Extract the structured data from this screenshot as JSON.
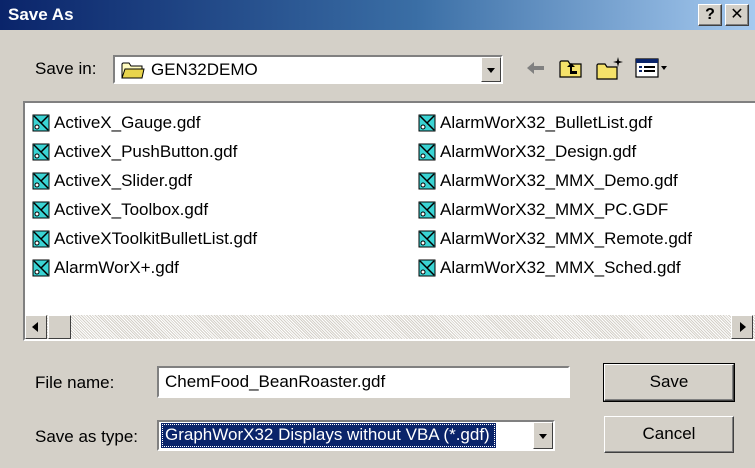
{
  "window": {
    "title": "Save As",
    "help_label": "?",
    "close_label": "✕"
  },
  "save_in": {
    "label": "Save in:",
    "folder": "GEN32DEMO"
  },
  "files": [
    "ActiveX_Gauge.gdf",
    "ActiveX_PushButton.gdf",
    "ActiveX_Slider.gdf",
    "ActiveX_Toolbox.gdf",
    "ActiveXToolkitBulletList.gdf",
    "AlarmWorX+.gdf",
    "AlarmWorX32_BulletList.gdf",
    "AlarmWorX32_Design.gdf",
    "AlarmWorX32_MMX_Demo.gdf",
    "AlarmWorX32_MMX_PC.GDF",
    "AlarmWorX32_MMX_Remote.gdf",
    "AlarmWorX32_MMX_Sched.gdf"
  ],
  "file_name": {
    "label": "File name:",
    "value": "ChemFood_BeanRoaster.gdf"
  },
  "save_as_type": {
    "label": "Save as type:",
    "value": "GraphWorX32 Displays without VBA (*.gdf)"
  },
  "buttons": {
    "save": "Save",
    "cancel": "Cancel"
  },
  "icons": {
    "folder": "folder-icon",
    "back": "back-arrow-icon",
    "up": "up-folder-icon",
    "new_folder": "new-folder-icon",
    "view_menu": "view-menu-icon",
    "file": "gdf-file-icon"
  },
  "colors": {
    "titlebar_start": "#0a246a",
    "titlebar_end": "#a6caf0",
    "dialog_bg": "#d4d0c8",
    "selection": "#0a246a"
  }
}
